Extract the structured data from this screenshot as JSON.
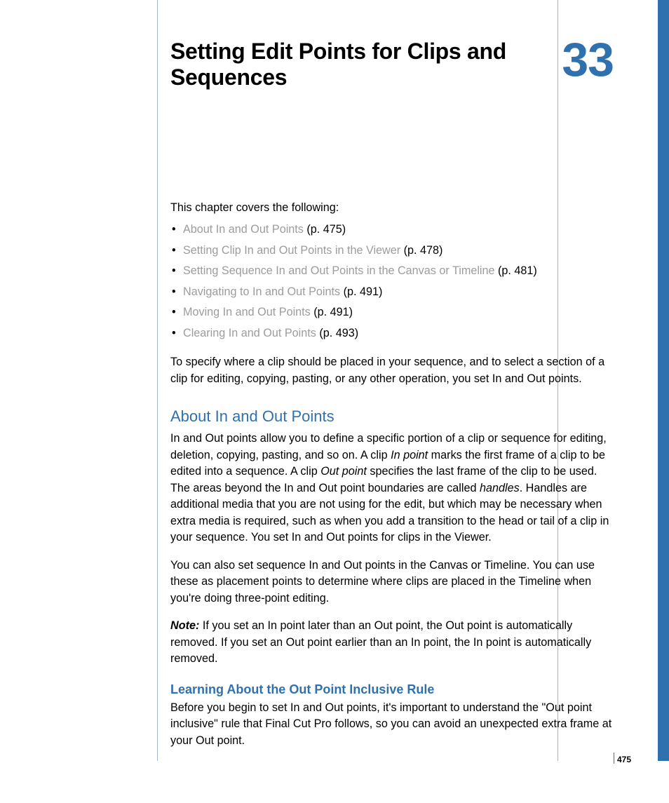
{
  "chapter": {
    "title": "Setting Edit Points for Clips and Sequences",
    "number": "33"
  },
  "intro": "This chapter covers the following:",
  "toc": [
    {
      "label": "About In and Out Points",
      "page": "(p. 475)"
    },
    {
      "label": "Setting Clip In and Out Points in the Viewer",
      "page": "(p. 478)"
    },
    {
      "label": "Setting Sequence In and Out Points in the Canvas or Timeline",
      "page": "(p. 481)"
    },
    {
      "label": "Navigating to In and Out Points",
      "page": "(p. 491)"
    },
    {
      "label": "Moving In and Out Points",
      "page": "(p. 491)"
    },
    {
      "label": "Clearing In and Out Points",
      "page": "(p. 493)"
    }
  ],
  "lead_para": "To specify where a clip should be placed in your sequence, and to select a section of a clip for editing, copying, pasting, or any other operation, you set In and Out points.",
  "section1": {
    "heading": "About In and Out Points",
    "p1a": "In and Out points allow you to define a specific portion of a clip or sequence for editing, deletion, copying, pasting, and so on. A clip ",
    "p1_inpoint": "In point",
    "p1b": " marks the first frame of a clip to be edited into a sequence. A clip ",
    "p1_outpoint": "Out point",
    "p1c": " specifies the last frame of the clip to be used. The areas beyond the In and Out point boundaries are called ",
    "p1_handles": "handles",
    "p1d": ". Handles are additional media that you are not using for the edit, but which may be necessary when extra media is required, such as when you add a transition to the head or tail of a clip in your sequence. You set In and Out points for clips in the Viewer.",
    "p2": "You can also set sequence In and Out points in the Canvas or Timeline. You can use these as placement points to determine where clips are placed in the Timeline when you're doing three-point editing.",
    "note_label": "Note:  ",
    "note_text": "If you set an In point later than an Out point, the Out point is automatically removed. If you set an Out point earlier than an In point, the In point is automatically removed."
  },
  "section2": {
    "heading": "Learning About the Out Point Inclusive Rule",
    "p1": "Before you begin to set In and Out points, it's important to understand the \"Out point inclusive\" rule that Final Cut Pro follows, so you can avoid an unexpected extra frame at your Out point."
  },
  "page_number": "475"
}
